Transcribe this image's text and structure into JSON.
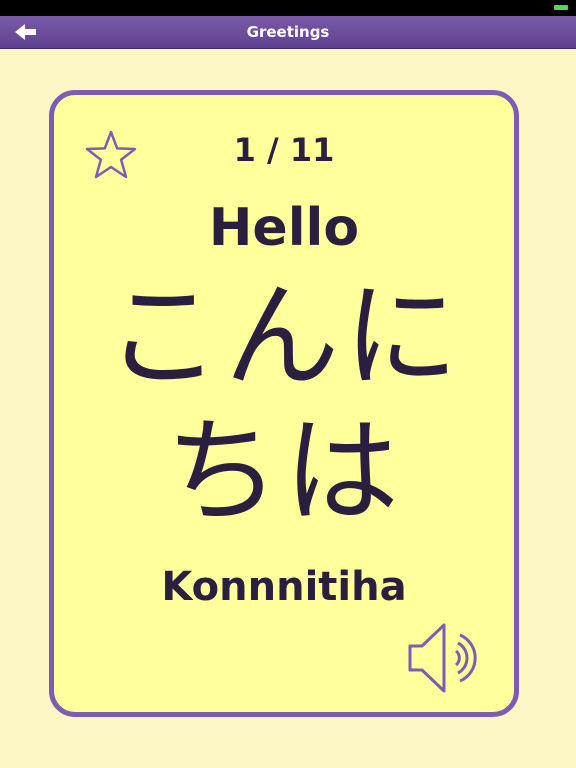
{
  "nav": {
    "title": "Greetings",
    "back_icon": "back-arrow-icon"
  },
  "card": {
    "counter": "1 / 11",
    "english": "Hello",
    "japanese_line1": "こんに",
    "japanese_line2": "ちは",
    "romaji": "Konnnitiha",
    "favorite_icon": "star-outline-icon",
    "audio_icon": "speaker-icon"
  },
  "colors": {
    "background": "#fdf7c5",
    "card_fill": "#ffff9c",
    "accent_purple": "#7d5cb6",
    "nav_bar": "#6a4b9c",
    "text": "#2b1f3f"
  }
}
